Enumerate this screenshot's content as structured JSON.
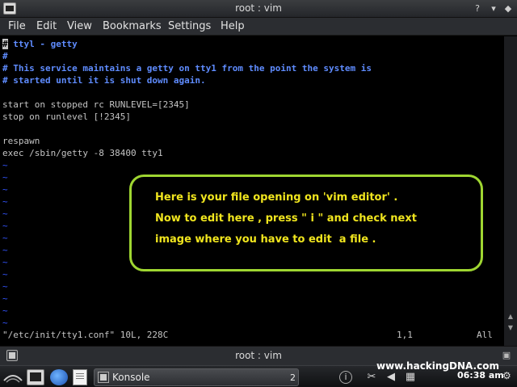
{
  "window": {
    "title": "root : vim",
    "menu": [
      "File",
      "Edit",
      "View",
      "Bookmarks",
      "Settings",
      "Help"
    ]
  },
  "editor": {
    "lines": [
      {
        "text": "# ttyl - getty",
        "kind": "comment"
      },
      {
        "text": "#",
        "kind": "comment"
      },
      {
        "text": "# This service maintains a getty on tty1 from the point the system is",
        "kind": "comment"
      },
      {
        "text": "# started until it is shut down again.",
        "kind": "comment"
      },
      {
        "text": "",
        "kind": "plain"
      },
      {
        "text": "start on stopped rc RUNLEVEL=[2345]",
        "kind": "plain"
      },
      {
        "text": "stop on runlevel [!2345]",
        "kind": "plain"
      },
      {
        "text": "",
        "kind": "plain"
      },
      {
        "text": "respawn",
        "kind": "plain"
      },
      {
        "text": "exec /sbin/getty -8 38400 tty1",
        "kind": "plain"
      }
    ],
    "tilde": "~",
    "status_file": "\"/etc/init/tty1.conf\" 10L, 228C",
    "status_pos": "1,1",
    "status_scroll": "All"
  },
  "callout": {
    "lines": [
      "Here is your file opening on 'vim editor' .",
      "Now to edit here , press \" i \" and check next",
      "image where you have to edit  a file ."
    ],
    "border_color": "#9fd631",
    "text_color": "#f0e51e"
  },
  "tab": {
    "title": "root : vim"
  },
  "taskbar": {
    "task_label": "Konsole",
    "task_count": "2",
    "watermark": "www.hackingDNA.com",
    "clock": "06:38 am"
  }
}
